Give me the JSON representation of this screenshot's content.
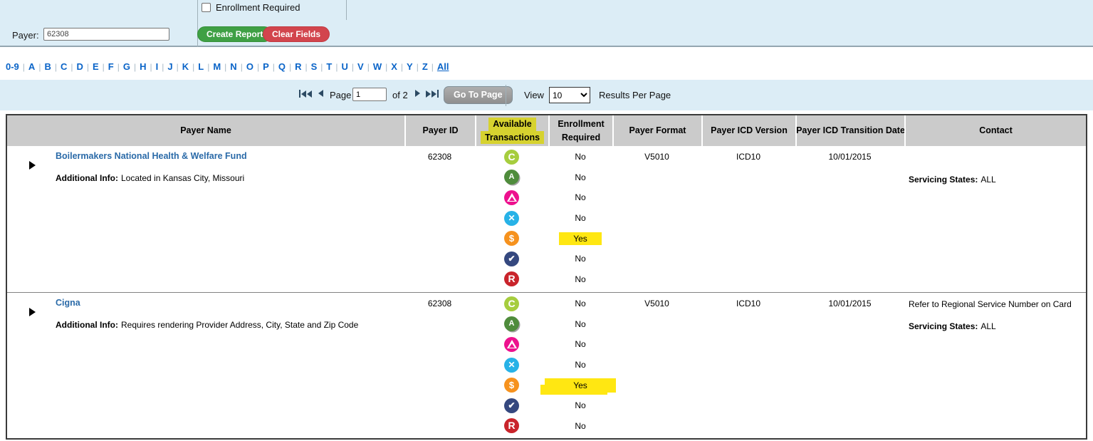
{
  "colors": {
    "panel_bg": "#dcedf6",
    "create_report_button": "#3fa044",
    "clear_fields_button": "#d2454d",
    "link_blue": "#2a6aa8",
    "alphabet_blue": "#0a64c8",
    "table_header_bg": "#cbcbcb",
    "row_highlight_yellow": "#ffe712",
    "header_highlight_yellow": "#d6d22f"
  },
  "filter_panel": {
    "payer_label": "Payer:",
    "payer_value": "62308",
    "enrollment_checkbox_label": "Enrollment Required",
    "create_report_button": "Create Report",
    "clear_fields_button": "Clear Fields"
  },
  "alphabet_nav": {
    "items": [
      "0-9",
      "A",
      "B",
      "C",
      "D",
      "E",
      "F",
      "G",
      "H",
      "I",
      "J",
      "K",
      "L",
      "M",
      "N",
      "O",
      "P",
      "Q",
      "R",
      "S",
      "T",
      "U",
      "V",
      "W",
      "X",
      "Y",
      "Z",
      "All"
    ]
  },
  "pagination": {
    "page_label": "Page",
    "page_value": "1",
    "of_label": "of 2",
    "go_to_page_button": "Go To Page",
    "view_label": "View",
    "view_value": "10",
    "results_per_page_label": "Results Per Page"
  },
  "table": {
    "headers": {
      "payer_name": "Payer Name",
      "payer_id": "Payer ID",
      "available_transactions_line1": "Available",
      "available_transactions_line2": "Transactions",
      "enrollment_required": "Enrollment Required",
      "payer_format": "Payer Format",
      "payer_icd_version": "Payer ICD Version",
      "payer_icd_transition_date": "Payer ICD Transition Date",
      "contact": "Contact"
    },
    "transaction_icons": [
      {
        "name": "letter-c",
        "glyph": "C",
        "color": "#a6cd3e"
      },
      {
        "name": "recycle-a",
        "glyph": "A",
        "color": "#4f8c3c"
      },
      {
        "name": "triangle-a",
        "glyph": "▲",
        "color": "#ed118e"
      },
      {
        "name": "x-cross",
        "glyph": "✕",
        "color": "#27b2e7"
      },
      {
        "name": "dollar",
        "glyph": "$",
        "color": "#f6921e"
      },
      {
        "name": "check",
        "glyph": "✔",
        "color": "#35487f"
      },
      {
        "name": "letter-r",
        "glyph": "R",
        "color": "#c9242b"
      }
    ],
    "rows": [
      {
        "payer_name": "Boilermakers National Health & Welfare Fund",
        "payer_id": "62308",
        "additional_info_label": "Additional Info:",
        "additional_info": "Located in Kansas City, Missouri",
        "enrollment": [
          "No",
          "No",
          "No",
          "No",
          "Yes",
          "No",
          "No"
        ],
        "enrollment_highlight_index": 4,
        "highlight_style": "compact",
        "payer_format": "V5010",
        "payer_icd_version": "ICD10",
        "payer_icd_transition_date": "10/01/2015",
        "contact_line1": "",
        "servicing_states_label": "Servicing States:",
        "servicing_states_value": "ALL"
      },
      {
        "payer_name": "Cigna",
        "payer_id": "62308",
        "additional_info_label": "Additional Info:",
        "additional_info": "Requires rendering Provider Address, City, State and Zip Code",
        "enrollment": [
          "No",
          "No",
          "No",
          "No",
          "Yes",
          "No",
          "No"
        ],
        "enrollment_highlight_index": 4,
        "highlight_style": "wide",
        "payer_format": "V5010",
        "payer_icd_version": "ICD10",
        "payer_icd_transition_date": "10/01/2015",
        "contact_line1": "Refer to Regional Service Number on Card",
        "servicing_states_label": "Servicing States:",
        "servicing_states_value": "ALL"
      }
    ]
  }
}
